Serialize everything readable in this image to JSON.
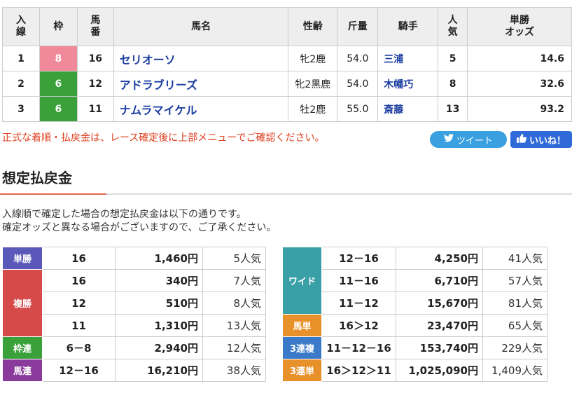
{
  "result_table": {
    "headers": [
      "入\n線",
      "枠",
      "馬\n番",
      "馬名",
      "性齢",
      "斤量",
      "騎手",
      "人\n気",
      "単勝\nオッズ"
    ],
    "rows": [
      {
        "pos": "1",
        "waku": "8",
        "waku_color": "#f08a9a",
        "umaban": "16",
        "name": "セリオーソ",
        "sexage": "牝2鹿",
        "weight": "54.0",
        "jockey": "三浦",
        "pop": "5",
        "odds": "14.6"
      },
      {
        "pos": "2",
        "waku": "6",
        "waku_color": "#3aa13a",
        "umaban": "12",
        "name": "アドラブリーズ",
        "sexage": "牝2黒鹿",
        "weight": "54.0",
        "jockey": "木幡巧",
        "pop": "8",
        "odds": "32.6"
      },
      {
        "pos": "3",
        "waku": "6",
        "waku_color": "#3aa13a",
        "umaban": "11",
        "name": "ナムラマイケル",
        "sexage": "牡2鹿",
        "weight": "55.0",
        "jockey": "斎藤",
        "pop": "13",
        "odds": "93.2"
      }
    ]
  },
  "notice": "正式な着順・払戻金は、レース確定後に上部メニューでご確認ください。",
  "sns": {
    "tweet_label": "ツイート",
    "like_label": "いいね！"
  },
  "section": {
    "title": "想定払戻金",
    "desc_line1": "入線順で確定した場合の想定払戻金は以下の通りです。",
    "desc_line2": "確定オッズと異なる場合がございますので、ご了承ください。"
  },
  "payouts_left": [
    {
      "label": "単勝",
      "color": "#5a58b8",
      "rows": [
        {
          "comb": "16",
          "amount": "1,460円",
          "pop": "5人気"
        }
      ]
    },
    {
      "label": "複勝",
      "color": "#d64a4a",
      "rows": [
        {
          "comb": "16",
          "amount": "340円",
          "pop": "7人気"
        },
        {
          "comb": "12",
          "amount": "510円",
          "pop": "8人気"
        },
        {
          "comb": "11",
          "amount": "1,310円",
          "pop": "13人気"
        }
      ]
    },
    {
      "label": "枠連",
      "color": "#3aa13a",
      "rows": [
        {
          "comb": "6－8",
          "amount": "2,940円",
          "pop": "12人気"
        }
      ]
    },
    {
      "label": "馬連",
      "color": "#8a3a9a",
      "rows": [
        {
          "comb": "12－16",
          "amount": "16,210円",
          "pop": "38人気"
        }
      ]
    }
  ],
  "payouts_right": [
    {
      "label": "ワイド",
      "color": "#3aa0a8",
      "rows": [
        {
          "comb": "12－16",
          "amount": "4,250円",
          "pop": "41人気"
        },
        {
          "comb": "11－16",
          "amount": "6,710円",
          "pop": "57人気"
        },
        {
          "comb": "11－12",
          "amount": "15,670円",
          "pop": "81人気"
        }
      ]
    },
    {
      "label": "馬単",
      "color": "#e8902a",
      "rows": [
        {
          "comb": "16＞12",
          "amount": "23,470円",
          "pop": "65人気"
        }
      ]
    },
    {
      "label": "3連複",
      "color": "#3a7ac8",
      "rows": [
        {
          "comb": "11－12－16",
          "amount": "153,740円",
          "pop": "229人気"
        }
      ]
    },
    {
      "label": "3連単",
      "color": "#e8902a",
      "rows": [
        {
          "comb": "16＞12＞11",
          "amount": "1,025,090円",
          "pop": "1,409人気"
        }
      ]
    }
  ]
}
